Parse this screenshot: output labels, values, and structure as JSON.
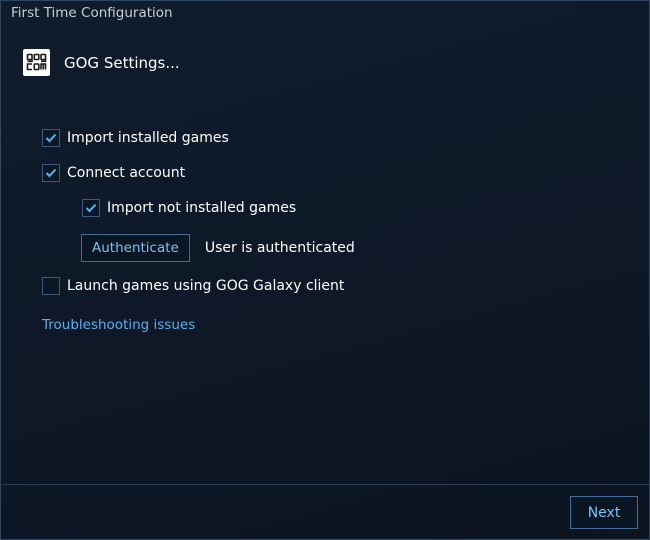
{
  "window": {
    "title": "First Time Configuration"
  },
  "header": {
    "logo_icon": "gog-logo-icon",
    "title": "GOG Settings..."
  },
  "options": {
    "import_installed": {
      "label": "Import installed games",
      "checked": true
    },
    "connect_account": {
      "label": "Connect account",
      "checked": true
    },
    "import_not_installed": {
      "label": "Import not installed games",
      "checked": true
    },
    "launch_galaxy": {
      "label": "Launch games using GOG Galaxy client",
      "checked": false
    }
  },
  "auth": {
    "button_label": "Authenticate",
    "status": "User is authenticated"
  },
  "troubleshooting_link": "Troubleshooting issues",
  "footer": {
    "next_label": "Next"
  },
  "colors": {
    "background": "#0e1827",
    "accent": "#55b2ee",
    "checkmark": "#56b4f0",
    "border": "#3d6e9a"
  }
}
